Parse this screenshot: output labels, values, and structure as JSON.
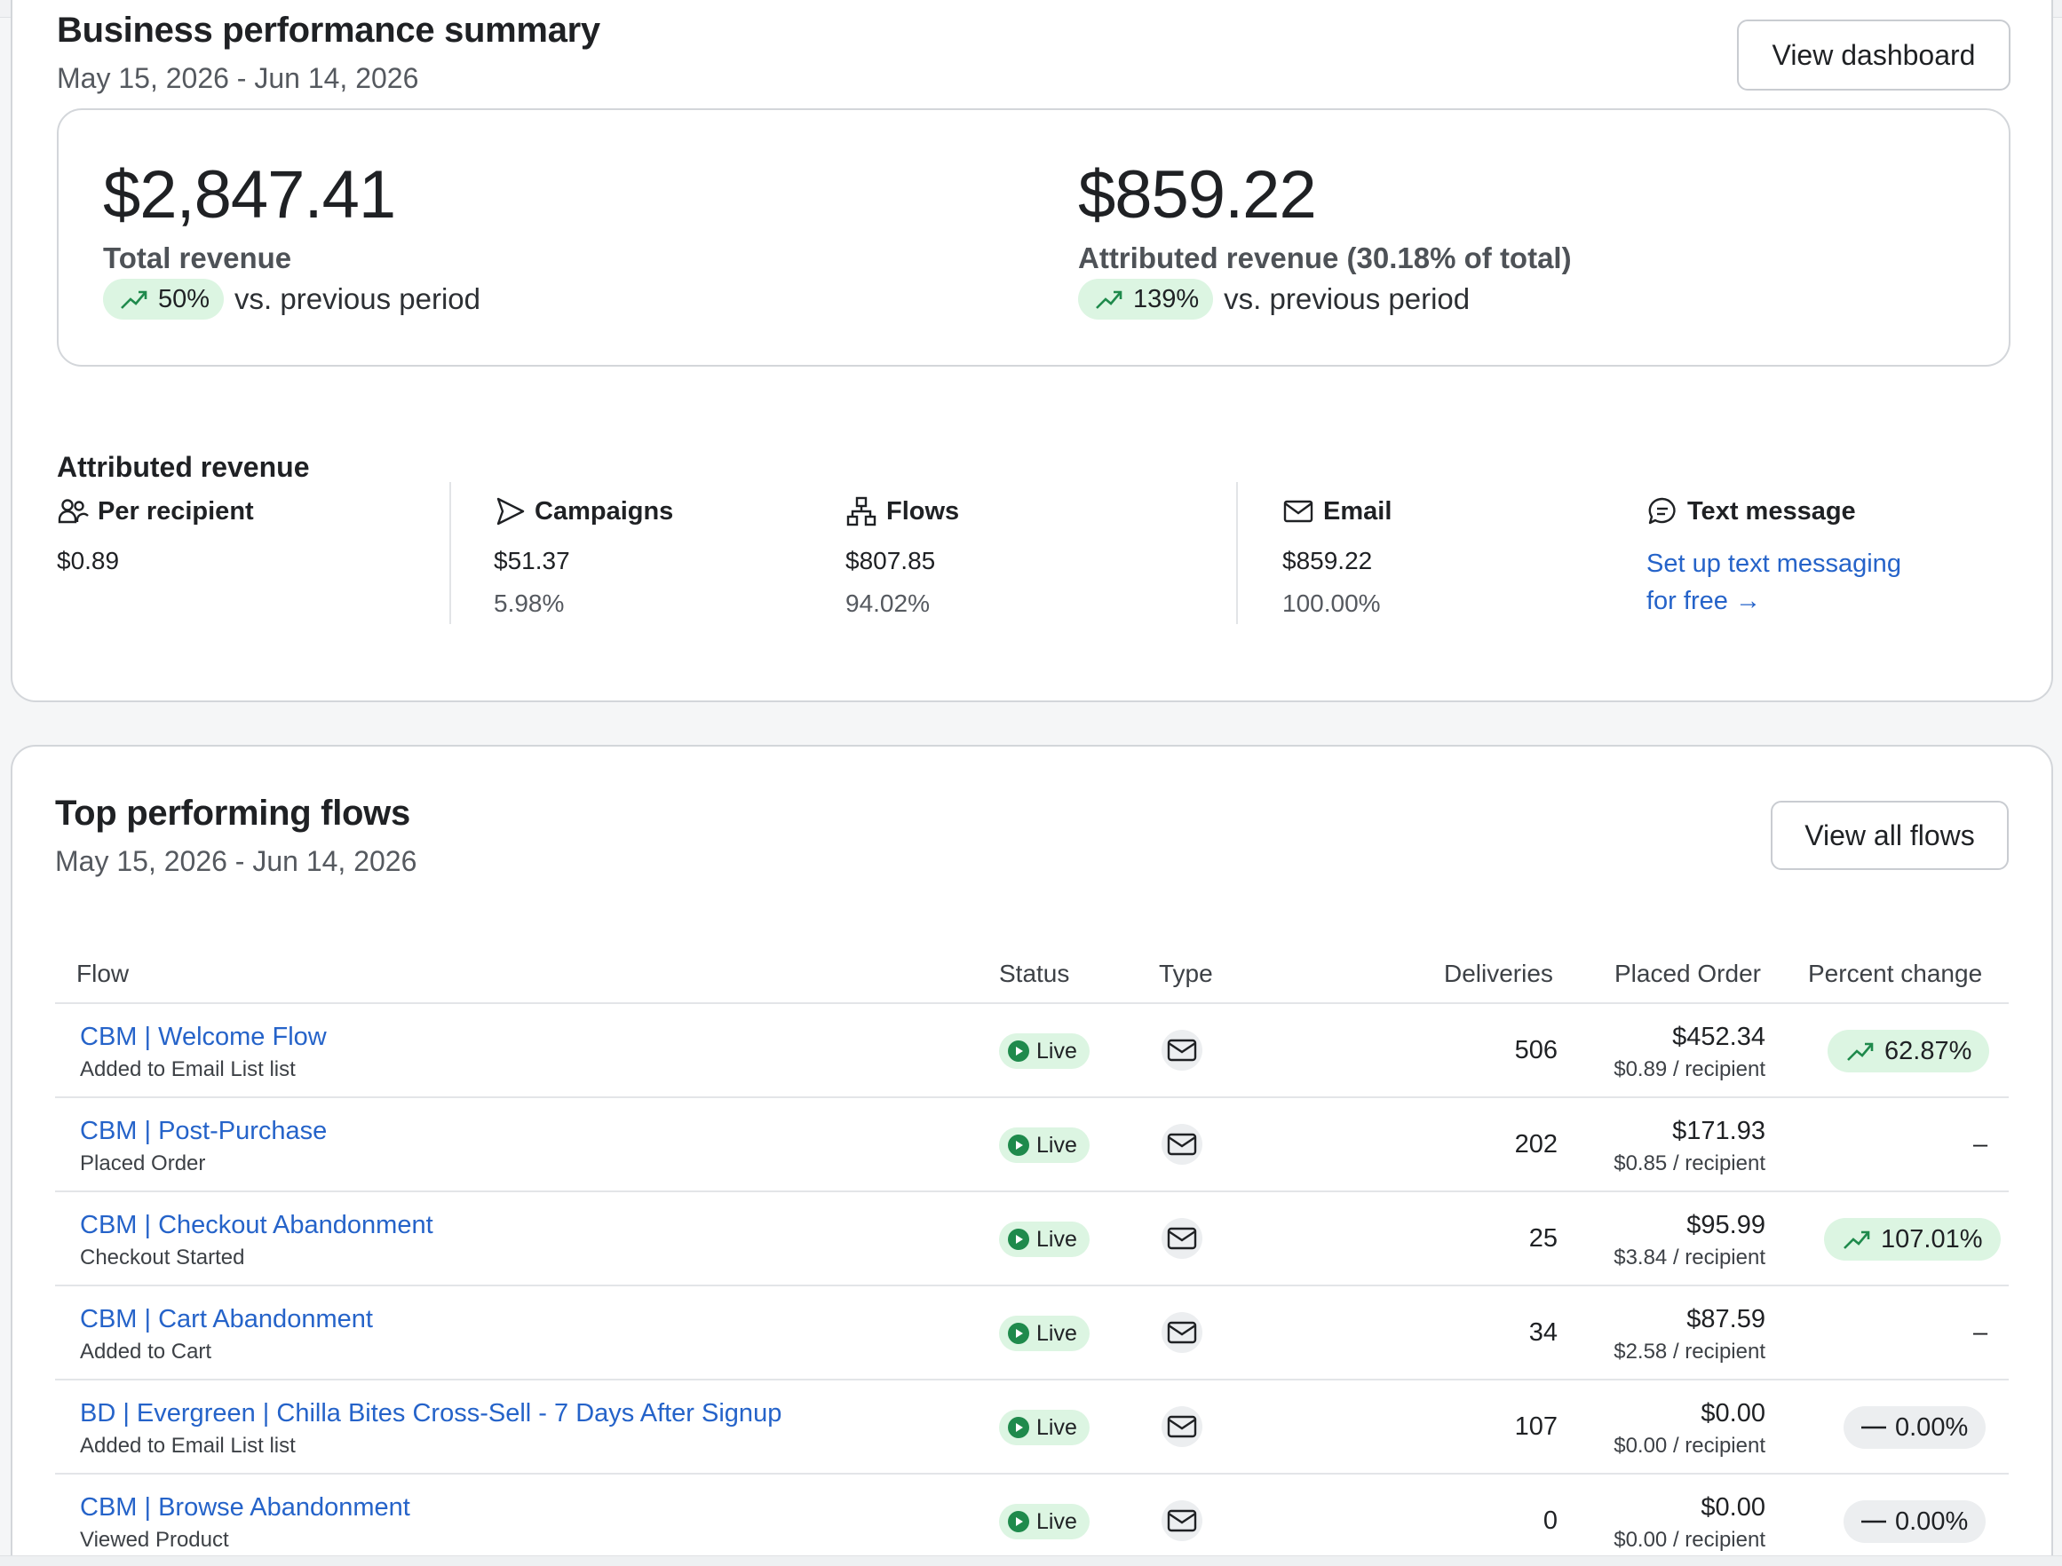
{
  "summary": {
    "title": "Business performance summary",
    "date_range": "May 15, 2026 - Jun 14, 2026",
    "view_dashboard_label": "View dashboard",
    "total_revenue": {
      "value": "$2,847.41",
      "label": "Total revenue",
      "change": "50%",
      "comparison": "vs. previous period"
    },
    "attributed_revenue": {
      "value": "$859.22",
      "label": "Attributed revenue (30.18% of total)",
      "change": "139%",
      "comparison": "vs. previous period"
    }
  },
  "attributed": {
    "title": "Attributed revenue",
    "per_recipient": {
      "label": "Per recipient",
      "value": "$0.89"
    },
    "campaigns": {
      "label": "Campaigns",
      "value": "$51.37",
      "pct": "5.98%"
    },
    "flows": {
      "label": "Flows",
      "value": "$807.85",
      "pct": "94.02%"
    },
    "email": {
      "label": "Email",
      "value": "$859.22",
      "pct": "100.00%"
    },
    "text_message": {
      "label": "Text message",
      "link_line1": "Set up text messaging",
      "link_line2": "for free",
      "arrow": "→"
    }
  },
  "flows": {
    "title": "Top performing flows",
    "date_range": "May 15, 2026 - Jun 14, 2026",
    "view_all_label": "View all flows",
    "columns": [
      "Flow",
      "Status",
      "Type",
      "Deliveries",
      "Placed Order",
      "Percent change"
    ],
    "rows": [
      {
        "name": "CBM | Welcome Flow",
        "trigger": "Added to Email List list",
        "status": "Live",
        "type": "email",
        "deliveries": "506",
        "placed_order": "$452.34",
        "per_recipient": "$0.89 / recipient",
        "change": "62.87%",
        "change_kind": "up"
      },
      {
        "name": "CBM | Post-Purchase",
        "trigger": "Placed Order",
        "status": "Live",
        "type": "email",
        "deliveries": "202",
        "placed_order": "$171.93",
        "per_recipient": "$0.85 / recipient",
        "change": "–",
        "change_kind": "none"
      },
      {
        "name": "CBM | Checkout Abandonment",
        "trigger": "Checkout Started",
        "status": "Live",
        "type": "email",
        "deliveries": "25",
        "placed_order": "$95.99",
        "per_recipient": "$3.84 / recipient",
        "change": "107.01%",
        "change_kind": "up"
      },
      {
        "name": "CBM | Cart Abandonment",
        "trigger": "Added to Cart",
        "status": "Live",
        "type": "email",
        "deliveries": "34",
        "placed_order": "$87.59",
        "per_recipient": "$2.58 / recipient",
        "change": "–",
        "change_kind": "none"
      },
      {
        "name": "BD | Evergreen | Chilla Bites Cross-Sell - 7 Days After Signup",
        "trigger": "Added to Email List list",
        "status": "Live",
        "type": "email",
        "deliveries": "107",
        "placed_order": "$0.00",
        "per_recipient": "$0.00 / recipient",
        "change": "0.00%",
        "change_kind": "flat"
      },
      {
        "name": "CBM | Browse Abandonment",
        "trigger": "Viewed Product",
        "status": "Live",
        "type": "email",
        "deliveries": "0",
        "placed_order": "$0.00",
        "per_recipient": "$0.00 / recipient",
        "change": "0.00%",
        "change_kind": "flat"
      }
    ]
  },
  "colors": {
    "accent_link": "#2563c9",
    "positive_bg": "#dcf5e2",
    "live_dot": "#1f8a4c"
  }
}
